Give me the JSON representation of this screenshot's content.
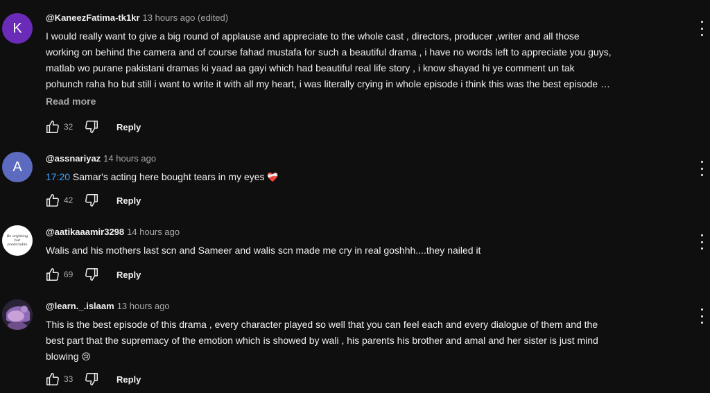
{
  "comments": [
    {
      "avatar_letter": "K",
      "author": "@KaneezFatima-tk1kr",
      "time": "13 hours ago (edited)",
      "text_lines": [
        "I would really want to give a big round of applause and appreciate to the whole cast , directors, producer ,writer and all those",
        "working on behind the camera and of course fahad mustafa for such a beautiful drama , i have no words left to appreciate you guys,",
        "matlab wo purane pakistani dramas ki yaad aa gayi which had beautiful real life story , i know shayad hi ye comment un tak",
        "pohunch raha ho but still i want to write it with all my heart, i was literally crying in whole episode i think this was the best episode …"
      ],
      "read_more": "Read more",
      "likes": "32",
      "reply": "Reply"
    },
    {
      "avatar_letter": "A",
      "author": "@assnariyaz",
      "time": "14 hours ago",
      "timestamp": "17:20",
      "text": " Samar's acting here bought tears in my eyes ",
      "emoji": "❤️‍🩹",
      "likes": "42",
      "reply": "Reply"
    },
    {
      "avatar_text": "Be anything but predictable",
      "author": "@aatikaaamir3298",
      "time": "14 hours ago",
      "text": "Walis and his mothers last scn and Sameer and walis scn made me cry in real goshhh....they nailed it",
      "likes": "69",
      "reply": "Reply"
    },
    {
      "author": "@learn._.islaam",
      "time": "13 hours ago",
      "text_lines": [
        "This is the best episode of this drama , every character played so well that you can feel each and every dialogue of them and the",
        "best part that the supremacy of the emotion which is showed by wali , his parents his brother and amal and her sister is just mind",
        "blowing "
      ],
      "emoji": "😢",
      "likes": "33",
      "reply": "Reply"
    }
  ]
}
